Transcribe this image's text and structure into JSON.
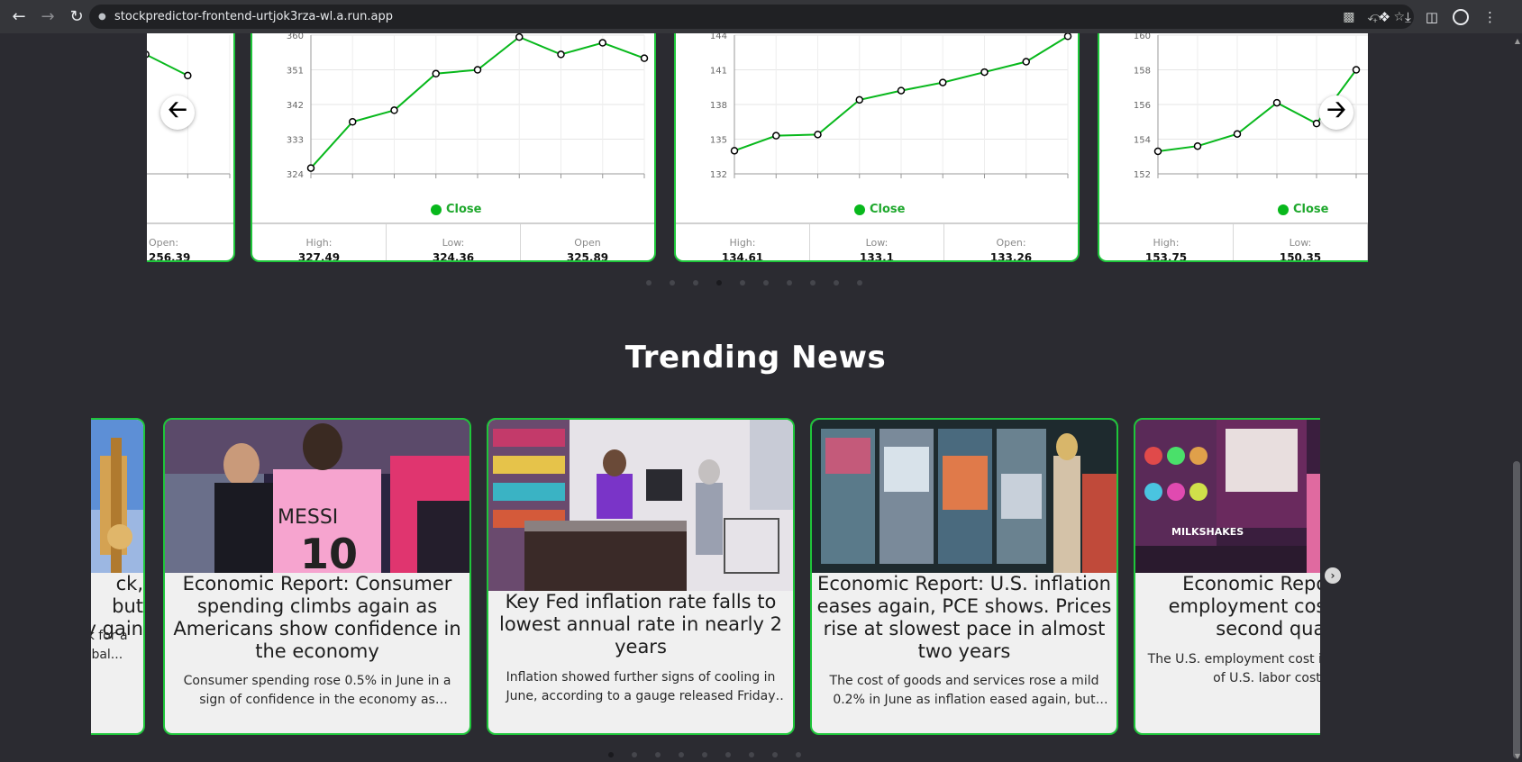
{
  "browser": {
    "url": "stockpredictor-frontend-urtjok3rza-wl.a.run.app"
  },
  "stocks": {
    "legend_label": "Close",
    "cards": [
      {
        "partial": true,
        "stats": [
          {
            "label": "Open:",
            "value": "256.39"
          }
        ]
      },
      {
        "y_ticks": [
          "360",
          "351",
          "342",
          "333",
          "324"
        ],
        "stats": [
          {
            "label": "High:",
            "value": "327.49"
          },
          {
            "label": "Low:",
            "value": "324.36"
          },
          {
            "label": "Open",
            "value": "325.89"
          }
        ]
      },
      {
        "y_ticks": [
          "144",
          "141",
          "138",
          "135",
          "132"
        ],
        "stats": [
          {
            "label": "High:",
            "value": "134.61"
          },
          {
            "label": "Low:",
            "value": "133.1"
          },
          {
            "label": "Open:",
            "value": "133.26"
          }
        ]
      },
      {
        "y_ticks": [
          "160",
          "158",
          "156",
          "154",
          "152"
        ],
        "stats": [
          {
            "label": "High:",
            "value": "153.75"
          },
          {
            "label": "Low:",
            "value": "150.35"
          }
        ]
      }
    ],
    "prev_icon": "arrow-left-icon",
    "next_icon": "arrow-right-icon",
    "pagination_count": 10,
    "pagination_active": 3
  },
  "news": {
    "title": "Trending News",
    "cards": [
      {
        "title_lines": [
          "ck, but",
          "y gain"
        ],
        "desc_lines": [
          "ck for a",
          "lobal..."
        ]
      },
      {
        "title": "Economic Report: Consumer spending climbs again as Americans show confidence in the economy",
        "desc": "Consumer spending rose 0.5% in June in a sign of confidence in the economy as inflation eased again"
      },
      {
        "title": "Key Fed inflation rate falls to lowest annual rate in nearly 2 years",
        "desc": "Inflation showed further signs of cooling in June, according to a gauge released Friday that the Federal Reserve watches"
      },
      {
        "title": "Economic Report: U.S. inflation eases again, PCE shows. Prices rise at slowest pace in almost two years",
        "desc": "The cost of goods and services rose a mild 0.2% in June as inflation eased again, but another measure"
      },
      {
        "title": "Economic Report: U.S. employment costs rise in second quarter",
        "desc": "The U.S. employment cost index, a measure of U.S. labor costs, rose"
      }
    ],
    "pagination_count": 9,
    "pagination_active": 0,
    "next_icon": "chevron-right-icon"
  },
  "chart_data": [
    {
      "type": "line",
      "series": [
        {
          "values": [
            355.0,
            349.5
          ]
        }
      ],
      "color": "#08b81c"
    },
    {
      "type": "line",
      "series": [
        {
          "values": [
            325.5,
            337.5,
            340.5,
            350.0,
            351.0,
            359.5,
            355.0,
            358.0,
            354.0
          ]
        }
      ],
      "ylim": [
        324,
        360
      ],
      "color": "#08b81c"
    },
    {
      "type": "line",
      "series": [
        {
          "values": [
            134.0,
            135.3,
            135.4,
            138.4,
            139.2,
            139.9,
            140.8,
            141.7,
            143.9
          ]
        }
      ],
      "ylim": [
        132,
        144
      ],
      "color": "#08b81c"
    },
    {
      "type": "line",
      "series": [
        {
          "values": [
            153.3,
            153.6,
            154.3,
            156.1,
            154.9,
            158.0
          ]
        }
      ],
      "ylim": [
        152,
        160
      ],
      "color": "#08b81c"
    }
  ]
}
